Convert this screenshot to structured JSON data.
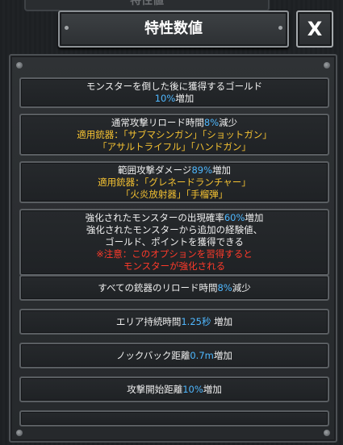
{
  "window": {
    "title": "特性数値",
    "close_label": "X",
    "background_title": "特性値"
  },
  "colors": {
    "value_highlight": "#4fb8ff",
    "weapon_text": "#f5c232",
    "warning_text": "#ff3a2a"
  },
  "stats": [
    {
      "lines": [
        [
          {
            "t": "モンスターを倒した後に獲得するゴールド",
            "c": "white"
          }
        ],
        [
          {
            "t": "10%",
            "c": "blue"
          },
          {
            "t": "増加",
            "c": "white"
          }
        ]
      ]
    },
    {
      "lines": [
        [
          {
            "t": "通常攻撃リロード時間",
            "c": "white"
          },
          {
            "t": "8%",
            "c": "blue"
          },
          {
            "t": "減少",
            "c": "white"
          }
        ],
        [
          {
            "t": "適用銃器：「サブマシンガン」「ショットガン」",
            "c": "yellow"
          }
        ],
        [
          {
            "t": "「アサルトライフル」「ハンドガン」",
            "c": "yellow"
          }
        ]
      ]
    },
    {
      "lines": [
        [
          {
            "t": "範囲攻撃ダメージ",
            "c": "white"
          },
          {
            "t": "89%",
            "c": "blue"
          },
          {
            "t": "増加",
            "c": "white"
          }
        ],
        [
          {
            "t": "適用銃器：「グレネードランチャー」",
            "c": "yellow"
          }
        ],
        [
          {
            "t": "「火炎放射器」「手榴弾」",
            "c": "yellow"
          }
        ]
      ]
    },
    {
      "lines": [
        [
          {
            "t": "強化されたモンスターの出現確率",
            "c": "white"
          },
          {
            "t": "60%",
            "c": "blue"
          },
          {
            "t": "増加",
            "c": "white"
          }
        ],
        [
          {
            "t": "強化されたモンスターから追加の経験値、",
            "c": "white"
          }
        ],
        [
          {
            "t": "ゴールド、ポイントを獲得できる",
            "c": "white"
          }
        ],
        [
          {
            "t": "※注意：このオプションを習得すると",
            "c": "red"
          }
        ],
        [
          {
            "t": "モンスターが強化される",
            "c": "red"
          }
        ]
      ]
    },
    {
      "lines": [
        [
          {
            "t": "すべての銃器のリロード時間",
            "c": "white"
          },
          {
            "t": "8%",
            "c": "blue"
          },
          {
            "t": "減少",
            "c": "white"
          }
        ]
      ]
    },
    {
      "lines": [
        [
          {
            "t": "エリア持続時間",
            "c": "white"
          },
          {
            "t": "1.25秒",
            "c": "blue"
          },
          {
            "t": " 増加",
            "c": "white"
          }
        ]
      ]
    },
    {
      "lines": [
        [
          {
            "t": "ノックバック距離",
            "c": "white"
          },
          {
            "t": "0.7m",
            "c": "blue"
          },
          {
            "t": "増加",
            "c": "white"
          }
        ]
      ]
    },
    {
      "lines": [
        [
          {
            "t": "攻撃開始距離",
            "c": "white"
          },
          {
            "t": "10%",
            "c": "blue"
          },
          {
            "t": "増加",
            "c": "white"
          }
        ]
      ]
    }
  ]
}
